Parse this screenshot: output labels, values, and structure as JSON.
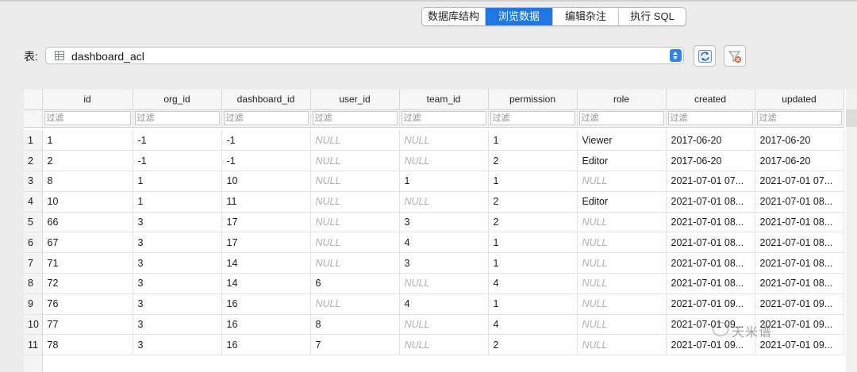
{
  "tabs": [
    {
      "label": "数据库结构",
      "active": false
    },
    {
      "label": "浏览数据",
      "active": true
    },
    {
      "label": "编辑杂注",
      "active": false
    },
    {
      "label": "执行 SQL",
      "active": false
    }
  ],
  "table_selector": {
    "label": "表:",
    "value": "dashboard_acl"
  },
  "grid": {
    "columns": [
      "id",
      "org_id",
      "dashboard_id",
      "user_id",
      "team_id",
      "permission",
      "role",
      "created",
      "updated"
    ],
    "filter_placeholder": "过滤",
    "rows": [
      {
        "n": "1",
        "cells": [
          "1",
          "-1",
          "-1",
          "NULL",
          "NULL",
          "1",
          "Viewer",
          "2017-06-20",
          "2017-06-20"
        ]
      },
      {
        "n": "2",
        "cells": [
          "2",
          "-1",
          "-1",
          "NULL",
          "NULL",
          "2",
          "Editor",
          "2017-06-20",
          "2017-06-20"
        ]
      },
      {
        "n": "3",
        "cells": [
          "8",
          "1",
          "10",
          "NULL",
          "1",
          "1",
          "NULL",
          "2021-07-01 07...",
          "2021-07-01 07..."
        ]
      },
      {
        "n": "4",
        "cells": [
          "10",
          "1",
          "11",
          "NULL",
          "NULL",
          "2",
          "Editor",
          "2021-07-01 08...",
          "2021-07-01 08..."
        ]
      },
      {
        "n": "5",
        "cells": [
          "66",
          "3",
          "17",
          "NULL",
          "3",
          "2",
          "NULL",
          "2021-07-01 08...",
          "2021-07-01 08..."
        ]
      },
      {
        "n": "6",
        "cells": [
          "67",
          "3",
          "17",
          "NULL",
          "4",
          "1",
          "NULL",
          "2021-07-01 08...",
          "2021-07-01 08..."
        ]
      },
      {
        "n": "7",
        "cells": [
          "71",
          "3",
          "14",
          "NULL",
          "3",
          "1",
          "NULL",
          "2021-07-01 08...",
          "2021-07-01 08..."
        ]
      },
      {
        "n": "8",
        "cells": [
          "72",
          "3",
          "14",
          "6",
          "NULL",
          "4",
          "NULL",
          "2021-07-01 08...",
          "2021-07-01 08..."
        ]
      },
      {
        "n": "9",
        "cells": [
          "76",
          "3",
          "16",
          "NULL",
          "4",
          "1",
          "NULL",
          "2021-07-01 09...",
          "2021-07-01 09..."
        ]
      },
      {
        "n": "10",
        "cells": [
          "77",
          "3",
          "16",
          "8",
          "NULL",
          "4",
          "NULL",
          "2021-07-01 09...",
          "2021-07-01 09..."
        ]
      },
      {
        "n": "11",
        "cells": [
          "78",
          "3",
          "16",
          "7",
          "NULL",
          "2",
          "NULL",
          "2021-07-01 09...",
          "2021-07-01 09..."
        ]
      }
    ]
  },
  "watermark": "天米谱",
  "icons": {
    "refresh": "refresh-icon",
    "clear_filter": "clear-filter-icon",
    "table": "table-icon"
  },
  "colors": {
    "accent": "#1e77e3",
    "null_text": "#b0b0b0"
  }
}
